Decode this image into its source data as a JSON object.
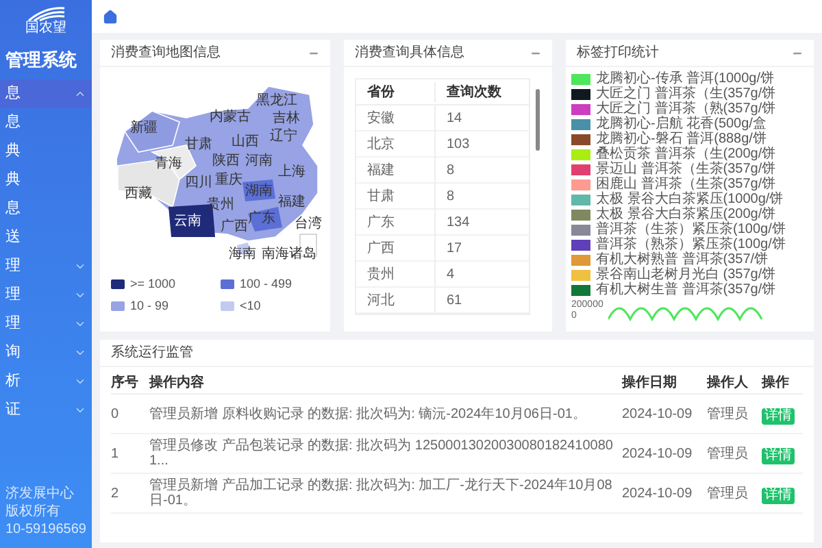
{
  "sidebar": {
    "logo_text": "国农望",
    "title": "管理系统",
    "menu": [
      {
        "label": "息",
        "expanded": true,
        "children": [
          {
            "label": "息"
          },
          {
            "label": "典"
          },
          {
            "label": "典"
          },
          {
            "label": "息"
          },
          {
            "label": "送"
          }
        ]
      },
      {
        "label": "理",
        "expanded": false
      },
      {
        "label": "理",
        "expanded": false
      },
      {
        "label": "理",
        "expanded": false
      },
      {
        "label": "询",
        "expanded": false
      },
      {
        "label": "析",
        "expanded": false
      },
      {
        "label": "证",
        "expanded": false
      }
    ],
    "footer": [
      "济发展中心",
      "版权所有",
      "10-59196569"
    ]
  },
  "map_card": {
    "title": "消费查询地图信息",
    "province_labels": [
      "黑龙江",
      "吉林",
      "内蒙古",
      "辽宁",
      "新疆",
      "甘肃",
      "山西",
      "青海",
      "陕西",
      "河南",
      "上海",
      "西藏",
      "四川",
      "重庆",
      "湖南",
      "福建",
      "贵州",
      "云南",
      "广西",
      "广东",
      "台湾",
      "海南",
      "南海诸岛"
    ],
    "legend": [
      {
        "label": ">= 1000",
        "color": "#1f2a78"
      },
      {
        "label": "100 - 499",
        "color": "#5b6fd6"
      },
      {
        "label": "10 - 99",
        "color": "#97a3e4"
      },
      {
        "label": "<10",
        "color": "#c3caf0"
      }
    ]
  },
  "query_card": {
    "title": "消费查询具体信息",
    "columns": [
      "省份",
      "查询次数"
    ],
    "rows": [
      [
        "安徽",
        "14"
      ],
      [
        "北京",
        "103"
      ],
      [
        "福建",
        "8"
      ],
      [
        "甘肃",
        "8"
      ],
      [
        "广东",
        "134"
      ],
      [
        "广西",
        "17"
      ],
      [
        "贵州",
        "4"
      ],
      [
        "河北",
        "61"
      ]
    ]
  },
  "label_card": {
    "title": "标签打印统计",
    "legend": [
      {
        "label": "龙腾初心-传承 普洱(1000g/饼",
        "color": "#4ee65a"
      },
      {
        "label": "大匠之门 普洱茶（生(357g/饼",
        "color": "#111820"
      },
      {
        "label": "大匠之门 普洱茶（熟(357g/饼",
        "color": "#cc3dbf"
      },
      {
        "label": "龙腾初心-启航 花香(500g/盒",
        "color": "#4a90a8"
      },
      {
        "label": "龙腾初心-磐石 普洱(888g/饼",
        "color": "#8a4a2a"
      },
      {
        "label": "叠松贡茶 普洱茶（生(200g/饼",
        "color": "#aaee11"
      },
      {
        "label": "景迈山 普洱茶（生茶(357g/饼",
        "color": "#e04070"
      },
      {
        "label": "困鹿山 普洱茶（生茶(357g/饼",
        "color": "#ff9a90"
      },
      {
        "label": "太极 景谷大白茶紧压(1000g/饼",
        "color": "#60b8a8"
      },
      {
        "label": "太极 景谷大白茶紧压(200g/饼",
        "color": "#808860"
      },
      {
        "label": "普洱茶（生茶）紧压茶(100g/饼",
        "color": "#888898"
      },
      {
        "label": "普洱茶（熟茶）紧压茶(100g/饼",
        "color": "#6040b8"
      },
      {
        "label": "有机大树熟普 普洱茶(357/饼",
        "color": "#e09838"
      },
      {
        "label": "景谷南山老树月光白 (357g/饼",
        "color": "#f0c040"
      },
      {
        "label": "有机大树生普 普洱茶(357g/饼",
        "color": "#107838"
      }
    ],
    "axis_labels": [
      "200000",
      "0"
    ]
  },
  "monitor_card": {
    "title": "系统运行监管",
    "columns": [
      "序号",
      "操作内容",
      "操作日期",
      "操作人",
      "操作"
    ],
    "rows": [
      {
        "index": "0",
        "content": "管理员新增 原料收购记录 的数据: 批次码为: 镝沅-2024年10月06日-01。",
        "date": "2024-10-09",
        "operator": "管理员",
        "action": "详情"
      },
      {
        "index": "1",
        "content": "管理员修改 产品包装记录 的数据: 批次码为 125000130200300801824100801...",
        "date": "2024-10-09",
        "operator": "管理员",
        "action": "详情"
      },
      {
        "index": "2",
        "content": "管理员新增 产品加工记录 的数据: 批次码为: 加工厂-龙行天下-2024年10月08日-01。",
        "date": "2024-10-09",
        "operator": "管理员",
        "action": "详情"
      }
    ]
  }
}
